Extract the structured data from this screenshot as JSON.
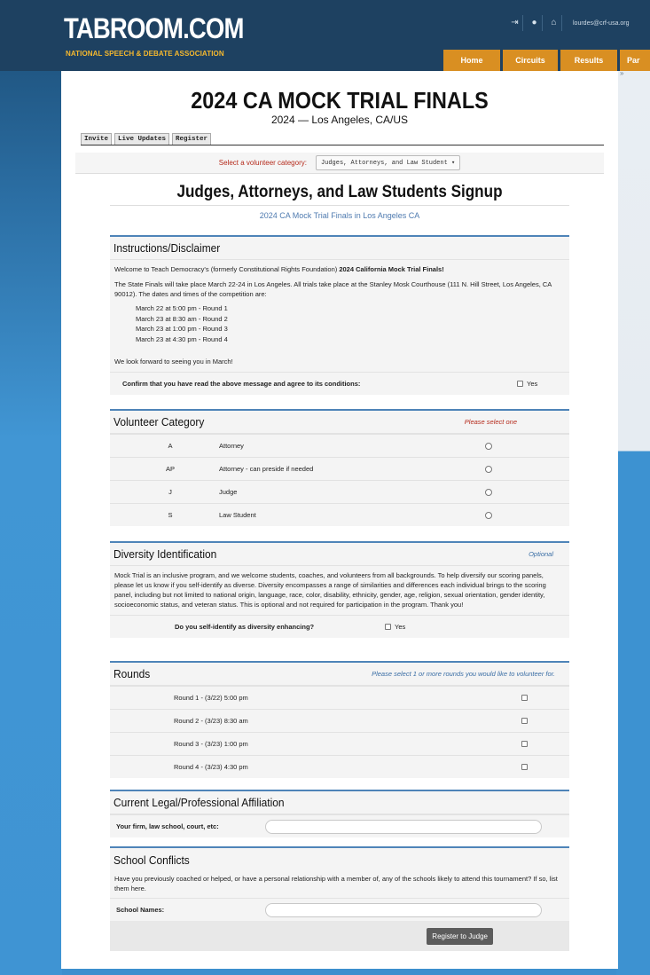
{
  "header": {
    "logo": "TABROOM.COM",
    "logo_sub": "NATIONAL SPEECH & DEBATE ASSOCIATION",
    "icons": [
      "exit-icon",
      "user-icon",
      "home-icon"
    ],
    "email": "lourdes@crf-usa.org",
    "nav": [
      "Home",
      "Circuits",
      "Results",
      "Par"
    ]
  },
  "tournament": {
    "title": "2024 CA MOCK TRIAL FINALS",
    "subtitle": "2024 — Los Angeles, CA/US"
  },
  "tabs": [
    "Invite",
    "Live Updates",
    "Register"
  ],
  "category_bar": {
    "label": "Select a volunteer category:",
    "selected": "Judges, Attorneys, and Law Student ▾"
  },
  "form": {
    "title": "Judges, Attorneys, and Law Students Signup",
    "subtitle": "2024 CA Mock Trial Finals in Los Angeles CA"
  },
  "instructions": {
    "title": "Instructions/Disclaimer",
    "welcome_prefix": "Welcome to Teach Democracy's (formerly Constitutional Rights Foundation) ",
    "welcome_bold": "2024 California Mock Trial Finals!",
    "para2": "The State Finals will take place March 22-24 in Los Angeles. All trials take place at the Stanley Mosk Courthouse (111 N. Hill Street, Los Angeles, CA 90012). The dates and times of the competition are:",
    "schedule": [
      "March 22 at 5:00 pm - Round 1",
      "March 23 at 8:30 am - Round 2",
      "March 23 at 1:00 pm - Round 3",
      "March 23 at 4:30 pm - Round 4"
    ],
    "closing": "We look forward to seeing you in March!",
    "confirm_label": "Confirm that you have read the above message and agree to its conditions:",
    "yes": "Yes"
  },
  "volunteer_category": {
    "title": "Volunteer Category",
    "note": "Please select one",
    "options": [
      {
        "code": "A",
        "name": "Attorney"
      },
      {
        "code": "AP",
        "name": "Attorney - can preside if needed"
      },
      {
        "code": "J",
        "name": "Judge"
      },
      {
        "code": "S",
        "name": "Law Student"
      }
    ]
  },
  "diversity": {
    "title": "Diversity Identification",
    "note": "Optional",
    "text": "Mock Trial is an inclusive program, and we welcome students, coaches, and volunteers from all backgrounds. To help diversify our scoring panels, please let us know if you self-identify as diverse. Diversity encompasses a range of similarities and differences each individual brings to the scoring panel, including but not limited to national origin, language, race, color, disability, ethnicity, gender, age, religion, sexual orientation, gender identity, socioeconomic status, and veteran status. This is optional and not required for participation in the program. Thank you!",
    "question": "Do you self-identify as diversity enhancing?",
    "yes": "Yes"
  },
  "rounds": {
    "title": "Rounds",
    "note": "Please select 1 or more rounds you would like to volunteer for.",
    "items": [
      "Round 1 - (3/22) 5:00 pm",
      "Round 2 - (3/23) 8:30 am",
      "Round 3 - (3/23) 1:00 pm",
      "Round 4 - (3/23) 4:30 pm"
    ]
  },
  "affiliation": {
    "title": "Current Legal/Professional Affiliation",
    "label": "Your firm, law school, court, etc:",
    "value": ""
  },
  "conflicts": {
    "title": "School Conflicts",
    "text": "Have you previously coached or helped, or have a personal relationship with a member of, any of the schools likely to attend this tournament? If so, list them here.",
    "label": "School Names:",
    "value": ""
  },
  "submit_label": "Register to Judge"
}
